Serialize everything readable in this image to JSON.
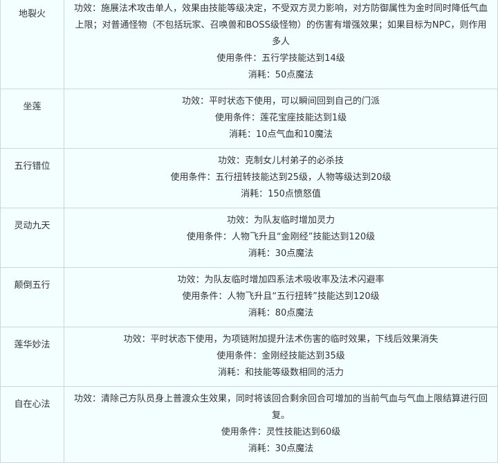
{
  "skills": [
    {
      "name": "地裂火",
      "effect": "功效：施展法术攻击单人，效果由技能等级决定，不受双方灵力影响，对方防御属性为金时同时降低气血上限；对普通怪物（不包括玩家、召唤兽和BOSS级怪物）的伤害有增强效果；如果目标为NPC，则作用多人",
      "condition": "使用条件：五行学技能达到14级",
      "cost": "消耗：50点魔法"
    },
    {
      "name": "坐莲",
      "effect": "功效：平时状态下使用，可以瞬间回到自己的门派",
      "condition": "使用条件：莲花宝座技能达到1级",
      "cost": "消耗：10点气血和10魔法"
    },
    {
      "name": "五行错位",
      "effect": "功效：克制女儿村弟子的必杀技",
      "condition": "使用条件：五行扭转技能达到25级，人物等级达到20级",
      "cost": "消耗：150点愤怒值"
    },
    {
      "name": "灵动九天",
      "effect": "功效：为队友临时增加灵力",
      "condition": "使用条件：人物飞升且“金刚经”技能达到120级",
      "cost": "消耗：30点魔法"
    },
    {
      "name": "颠倒五行",
      "effect": "功效：为队友临时增加四系法术吸收率及法术闪避率",
      "condition": "使用条件：人物飞升且“五行扭转”技能达到120级",
      "cost": "消耗：80点魔法"
    },
    {
      "name": "莲华妙法",
      "effect": "功效：平时状态下使用，为项链附加提升法术伤害的临时效果，下线后效果消失",
      "condition": "使用条件：金刚经技能达到35级",
      "cost": "消耗：和技能等级数相同的活力"
    },
    {
      "name": "自在心法",
      "effect": "功效：清除己方队员身上普渡众生效果，同时将该回合剩余回合可增加的当前气血与气血上限结算进行回复。",
      "condition": "使用条件：灵性技能达到60级",
      "cost": "消耗：30点魔法"
    }
  ]
}
